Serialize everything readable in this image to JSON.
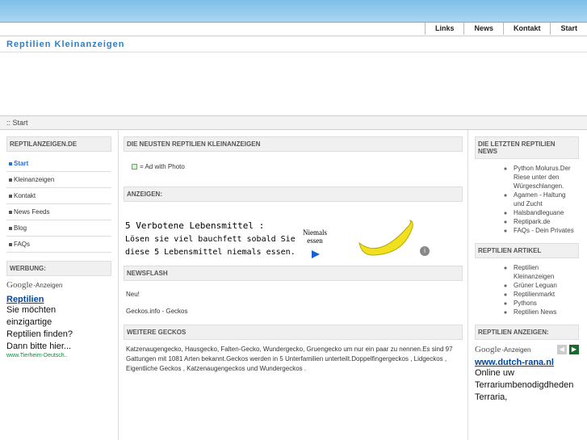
{
  "topnav": {
    "links": "Links",
    "news": "News",
    "kontakt": "Kontakt",
    "start": "Start"
  },
  "site_title": "Reptilien Kleinanzeigen",
  "breadcrumb": ":: Start",
  "left": {
    "box_title": "REPTILANZEIGEN.DE",
    "menu": [
      "Start",
      "Kleinanzeigen",
      "Kontakt",
      "News Feeds",
      "Blog",
      "FAQs"
    ],
    "ads_title": "WERBUNG:",
    "google": "Google",
    "anzeigen": "-Anzeigen",
    "ad_link": "Reptilien",
    "ad_text": "Sie möchten einzigartige Reptilien finden? Dann bitte hier...",
    "ad_url": "www.Tierheim-Deutsch.."
  },
  "mid": {
    "newest_title": "DIE NEUSTEN REPTILIEN KLEINANZEIGEN",
    "ad_with_photo": "= Ad with Photo",
    "anzeigen_title": "ANZEIGEN:",
    "banner_line1": "5 Verbotene Lebensmittel :",
    "banner_line2": "Lösen sie viel bauchfett sobald Sie",
    "banner_line3": "diese 5 Lebensmittel niemals essen.",
    "banner_side": "Niemals essen",
    "newsflash_title": "NEWSFLASH",
    "newsflash_line1": "Neu!",
    "newsflash_line2": "Geckos.info - Geckos",
    "weitere_title": "WEITERE GECKOS",
    "weitere_text": "Katzenaugengecko, Hausgecko, Falten-Gecko, Wundergecko, Gruengecko um nur ein paar zu nennen.Es sind 97 Gattungen mit 1081 Arten bekannt.Geckos werden in 5 Unterfamilien unterteilt.Doppelfingergeckos , Lidgeckos , Eigentliche Geckos , Katzenaugengeckos und Wundergeckos ."
  },
  "right": {
    "news_title": "DIE LETZTEN REPTILIEN NEWS",
    "news": [
      "Python Molurus.Der Riese unter den Würgeschlangen.",
      "Agamen - Haltung und Zucht",
      "Halsbandleguane",
      "Reptipark.de",
      "FAQs - Dein Privates"
    ],
    "artikel_title": "REPTILIEN ARTIKEL",
    "artikel": [
      "Reptilien Kleinanzeigen",
      "Grüner Leguan",
      "Reptilienmarkt",
      "Pythons",
      "Reptilien News"
    ],
    "anzeigen_title": "REPTILIEN ANZEIGEN:",
    "google": "Google",
    "anzeigen": "-Anzeigen",
    "ad_link": "www.dutch-rana.nl",
    "ad_text": "Online uw Terrariumbenodigdheden Terraria,"
  }
}
